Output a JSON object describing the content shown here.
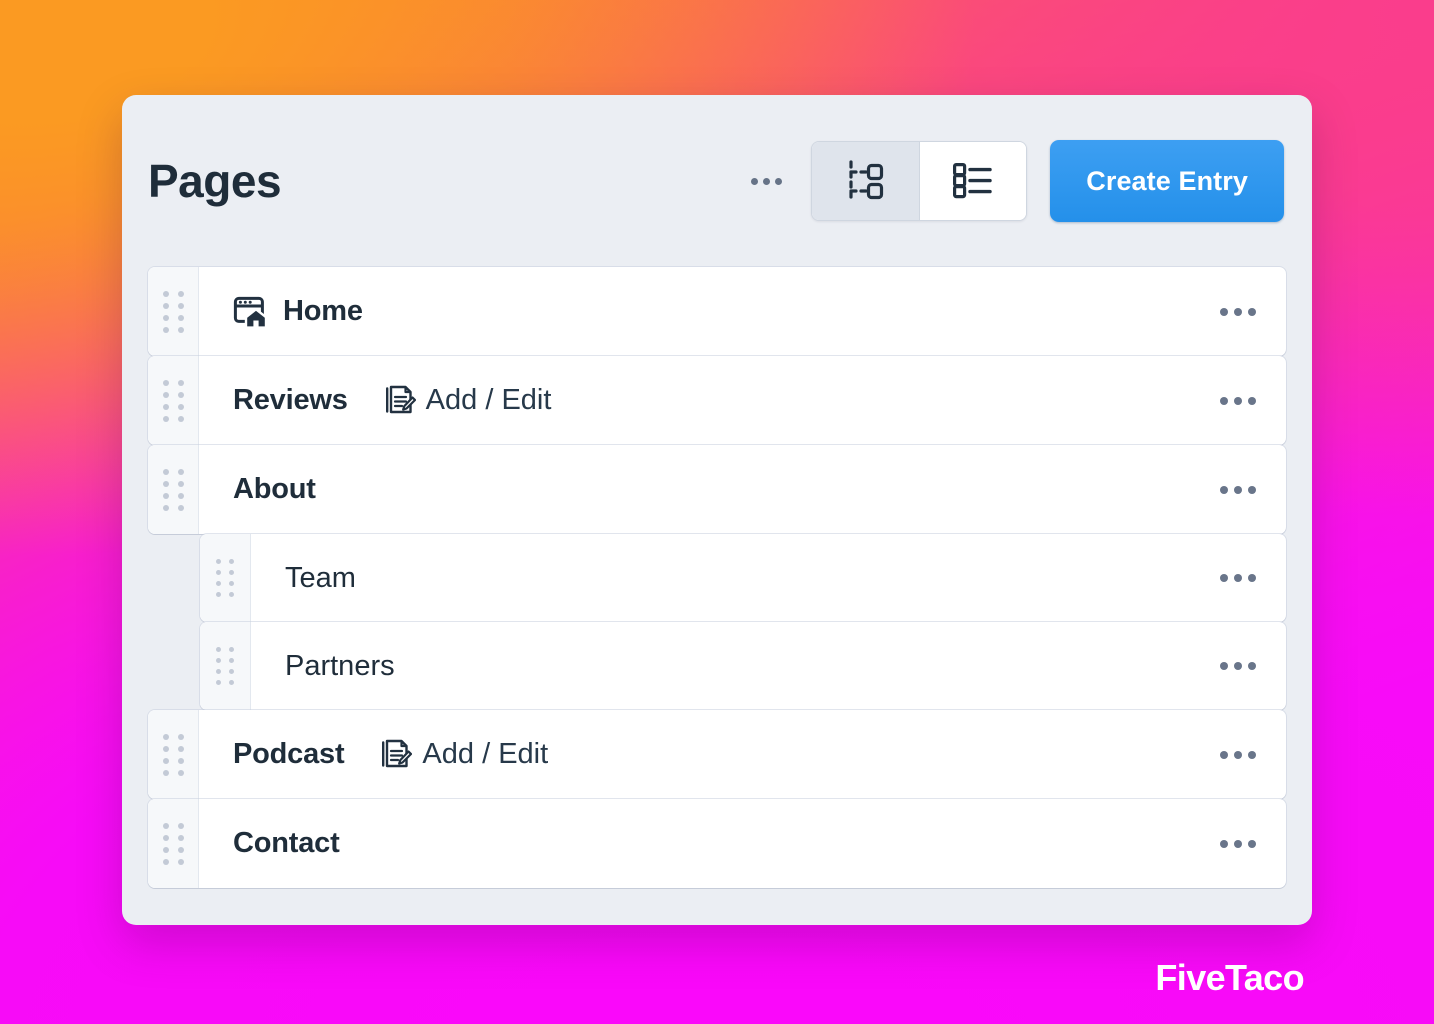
{
  "header": {
    "title": "Pages",
    "overflow_icon": "kebab-dots-icon",
    "view_toggle": [
      {
        "id": "tree",
        "icon": "tree-view-icon",
        "active": true
      },
      {
        "id": "list",
        "icon": "list-view-icon",
        "active": false
      }
    ],
    "create_button": "Create Entry"
  },
  "rows": [
    {
      "label": "Home",
      "bold": true,
      "indent": 0,
      "icon": "browser-home-icon",
      "action": null,
      "menu_icon": "kebab-dots-icon",
      "drag_handle": "drag-handle-icon"
    },
    {
      "label": "Reviews",
      "bold": true,
      "indent": 0,
      "icon": null,
      "action": {
        "icon": "document-edit-icon",
        "text": "Add / Edit"
      },
      "menu_icon": "kebab-dots-icon",
      "drag_handle": "drag-handle-icon"
    },
    {
      "label": "About",
      "bold": true,
      "indent": 0,
      "icon": null,
      "action": null,
      "menu_icon": "kebab-dots-icon",
      "drag_handle": "drag-handle-icon"
    },
    {
      "label": "Team",
      "bold": false,
      "indent": 1,
      "icon": null,
      "action": null,
      "menu_icon": "kebab-dots-icon",
      "drag_handle": "drag-handle-icon"
    },
    {
      "label": "Partners",
      "bold": false,
      "indent": 1,
      "icon": null,
      "action": null,
      "menu_icon": "kebab-dots-icon",
      "drag_handle": "drag-handle-icon"
    },
    {
      "label": "Podcast",
      "bold": true,
      "indent": 0,
      "icon": null,
      "action": {
        "icon": "document-edit-icon",
        "text": "Add / Edit"
      },
      "menu_icon": "kebab-dots-icon",
      "drag_handle": "drag-handle-icon"
    },
    {
      "label": "Contact",
      "bold": true,
      "indent": 0,
      "icon": null,
      "action": null,
      "menu_icon": "kebab-dots-icon",
      "drag_handle": "drag-handle-icon"
    }
  ],
  "branding": {
    "name": "FiveTaco"
  },
  "colors": {
    "accent_blue": "#2490ea",
    "card_bg": "#ebeef3",
    "row_bg": "#ffffff",
    "text_dark": "#1f2d3a",
    "handle_bg": "#f6f8fa",
    "dot_grey": "#c3cad6",
    "gradient_orange": "#fb9a22",
    "gradient_pink": "#fa3d8c",
    "gradient_magenta": "#fa0bfa"
  }
}
